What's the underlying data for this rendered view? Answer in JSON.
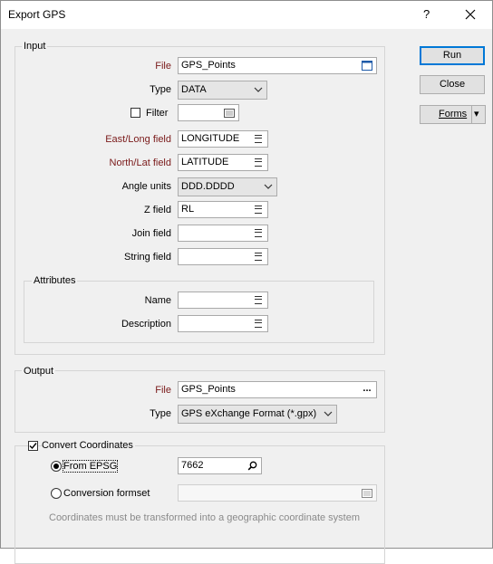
{
  "window": {
    "title": "Export GPS",
    "help": "?",
    "close_glyph": "✕"
  },
  "buttons": {
    "run": "Run",
    "close": "Close",
    "forms": "Forms",
    "forms_arrow": "▾"
  },
  "input": {
    "group_label": "Input",
    "file_label": "File",
    "file_value": "GPS_Points",
    "type_label": "Type",
    "type_value": "DATA",
    "filter_label": "Filter",
    "filter_checked": false,
    "filter_value": "",
    "east_label": "East/Long field",
    "east_value": "LONGITUDE",
    "north_label": "North/Lat field",
    "north_value": "LATITUDE",
    "angle_label": "Angle units",
    "angle_value": "DDD.DDDD",
    "z_label": "Z field",
    "z_value": "RL",
    "join_label": "Join field",
    "join_value": "",
    "string_label": "String field",
    "string_value": ""
  },
  "attributes": {
    "group_label": "Attributes",
    "name_label": "Name",
    "name_value": "",
    "description_label": "Description",
    "description_value": ""
  },
  "output": {
    "group_label": "Output",
    "file_label": "File",
    "file_value": "GPS_Points",
    "browse": "...",
    "type_label": "Type",
    "type_value": "GPS eXchange Format (*.gpx)"
  },
  "convert": {
    "label": "Convert Coordinates",
    "checked": true,
    "from_epsg_label": "From EPSG",
    "from_epsg_selected": true,
    "epsg_value": "7662",
    "formset_label": "Conversion formset",
    "formset_value": "",
    "note": "Coordinates must be transformed into a geographic coordinate system"
  },
  "colors": {
    "required_label": "#7a1a1a",
    "accent": "#0078d7"
  }
}
